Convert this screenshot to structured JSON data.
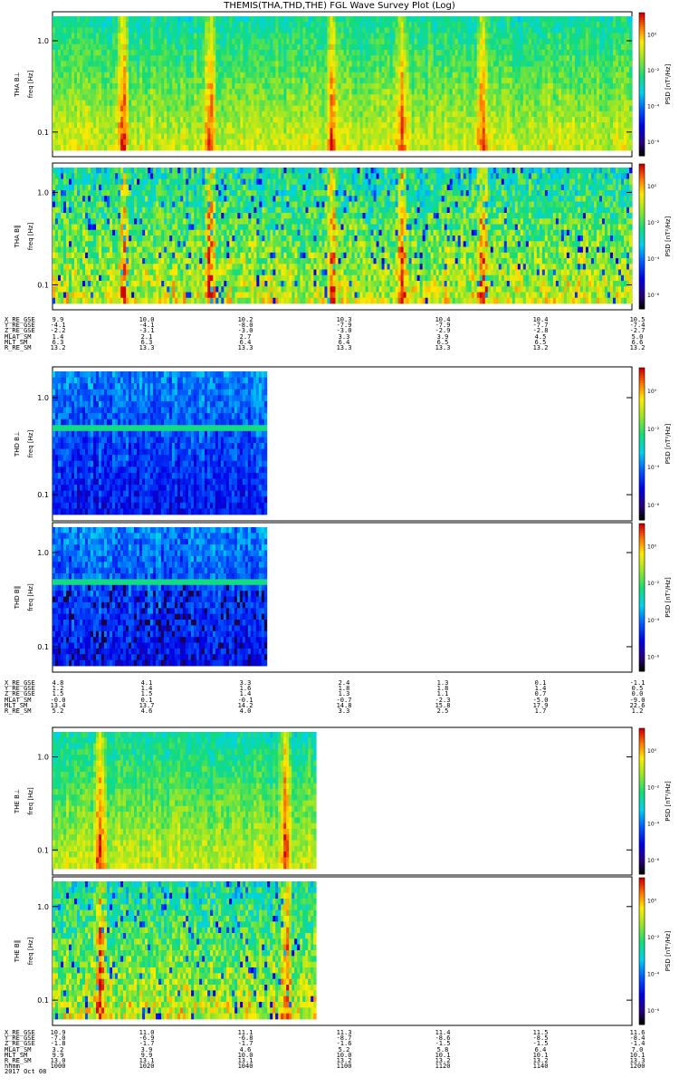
{
  "chart_data": {
    "type": "heatmap",
    "title": "THEMIS(THA,THD,THE) FGL Wave Survey Plot (Log)",
    "colorbar_label": "PSD [nT²/Hz]",
    "colorbar_ticks": [
      "10⁰",
      "10⁻²",
      "10⁻⁴",
      "10⁻⁶"
    ],
    "y_scale": "log",
    "y_ticks": [
      "1.0",
      "0.1"
    ],
    "freq_label": "freq [Hz]",
    "panels": [
      {
        "group": "THA",
        "ylabel": "THA B⊥",
        "component": "perp",
        "colorbar_ticks": [
          "10⁰",
          "10⁻²",
          "10⁻⁴",
          "10⁻⁶"
        ],
        "coverage": 1.0,
        "palette": "warm",
        "spikes": [
          0.12,
          0.27,
          0.48,
          0.6,
          0.74
        ]
      },
      {
        "group": "THA",
        "ylabel": "THA B‖",
        "component": "par",
        "colorbar_ticks": [
          "10⁰",
          "10⁻²",
          "10⁻⁴",
          "10⁻⁶"
        ],
        "coverage": 1.0,
        "palette": "warm",
        "spikes": [
          0.12,
          0.27,
          0.48,
          0.6,
          0.74
        ]
      },
      {
        "group": "THD",
        "ylabel": "THD B⊥",
        "component": "perp",
        "colorbar_ticks": [
          "10⁰",
          "10⁻²",
          "10⁻⁴",
          "10⁻⁶"
        ],
        "coverage": 0.37,
        "palette": "cool",
        "spikes": [
          0.42
        ]
      },
      {
        "group": "THD",
        "ylabel": "THD B‖",
        "component": "par",
        "colorbar_ticks": [
          "10⁰",
          "10⁻²",
          "10⁻⁴",
          "10⁻⁶"
        ],
        "coverage": 0.37,
        "palette": "cool",
        "spikes": [
          0.42
        ]
      },
      {
        "group": "THE",
        "ylabel": "THE B⊥",
        "component": "perp",
        "colorbar_ticks": [
          "10⁰",
          "10⁻²",
          "10⁻⁴",
          "10⁻⁶"
        ],
        "coverage": 0.455,
        "palette": "warm",
        "spikes": [
          0.08,
          0.4
        ]
      },
      {
        "group": "THE",
        "ylabel": "THE B‖",
        "component": "par",
        "colorbar_ticks": [
          "10⁰",
          "10⁻²",
          "10⁻⁴",
          "10⁻⁶"
        ],
        "coverage": 0.455,
        "palette": "warm",
        "spikes": [
          0.08,
          0.4
        ]
      }
    ],
    "ephemeris": [
      {
        "rows": [
          {
            "label": "X_RE_GSE",
            "values": [
              "9.9",
              "10.0",
              "10.2",
              "10.3",
              "10.4",
              "10.4",
              "10.5"
            ]
          },
          {
            "label": "Y_RE_GSE",
            "values": [
              "-4.1",
              "-4.1",
              "-8.0",
              "-7.9",
              "-7.9",
              "-7.7",
              "-7.4"
            ]
          },
          {
            "label": "Z_RE_GSE",
            "values": [
              "-2.2",
              "-3.1",
              "-3.0",
              "-3.0",
              "-2.9",
              "-2.8",
              "-2.7"
            ]
          },
          {
            "label": "MLAT_SM",
            "values": [
              "1.4",
              "2.1",
              "2.7",
              "3.3",
              "3.9",
              "4.5",
              "5.0"
            ]
          },
          {
            "label": "MLT_SM",
            "values": [
              "6.3",
              "6.3",
              "6.4",
              "6.4",
              "6.5",
              "6.5",
              "6.6"
            ]
          },
          {
            "label": "R_RE_SM",
            "values": [
              "13.2",
              "13.3",
              "13.3",
              "13.3",
              "13.3",
              "13.2",
              "13.2"
            ]
          }
        ]
      },
      {
        "rows": [
          {
            "label": "X_RE_GSE",
            "values": [
              "4.8",
              "4.1",
              "3.3",
              "2.4",
              "1.3",
              "0.1",
              "-1.1"
            ]
          },
          {
            "label": "Y_RE_GSE",
            "values": [
              "1.2",
              "1.4",
              "1.6",
              "1.8",
              "1.8",
              "1.4",
              "0.5"
            ]
          },
          {
            "label": "Z_RE_GSE",
            "values": [
              "1.5",
              "1.5",
              "1.4",
              "1.3",
              "1.1",
              "0.7",
              "0.0"
            ]
          },
          {
            "label": "MLAT_SM",
            "values": [
              "-0.0",
              "0.1",
              "-0.1",
              "-0.7",
              "-2.3",
              "-5.0",
              "-9.0"
            ]
          },
          {
            "label": "MLT_SM",
            "values": [
              "13.4",
              "13.7",
              "14.2",
              "14.8",
              "15.8",
              "17.9",
              "22.6"
            ]
          },
          {
            "label": "R_RE_SM",
            "values": [
              "5.2",
              "4.6",
              "4.0",
              "3.3",
              "2.5",
              "1.7",
              "1.2"
            ]
          }
        ]
      },
      {
        "rows": [
          {
            "label": "X_RE_GSE",
            "values": [
              "10.9",
              "11.0",
              "11.1",
              "11.3",
              "11.4",
              "11.5",
              "11.6"
            ]
          },
          {
            "label": "Y_RE_GSE",
            "values": [
              "-7.0",
              "-6.9",
              "-6.8",
              "-8.7",
              "-8.6",
              "-8.5",
              "-8.4"
            ]
          },
          {
            "label": "Z_RE_GSE",
            "values": [
              "-1.8",
              "-1.7",
              "-1.7",
              "-1.6",
              "-1.5",
              "-1.5",
              "-1.4"
            ]
          },
          {
            "label": "MLAT_SM",
            "values": [
              "3.2",
              "3.9",
              "4.6",
              "5.2",
              "5.8",
              "6.4",
              "7.0"
            ]
          },
          {
            "label": "MLT_SM",
            "values": [
              "9.9",
              "9.9",
              "10.0",
              "10.0",
              "10.1",
              "10.1",
              "10.1"
            ]
          },
          {
            "label": "R_RE_SM",
            "values": [
              "13.0",
              "13.1",
              "13.1",
              "13.2",
              "13.2",
              "13.2",
              "13.3"
            ]
          },
          {
            "label": "hhmm",
            "values": [
              "1000",
              "1020",
              "1040",
              "1100",
              "1120",
              "1140",
              "1200"
            ]
          },
          {
            "label": "2017 Oct 08",
            "values": []
          }
        ]
      }
    ]
  }
}
